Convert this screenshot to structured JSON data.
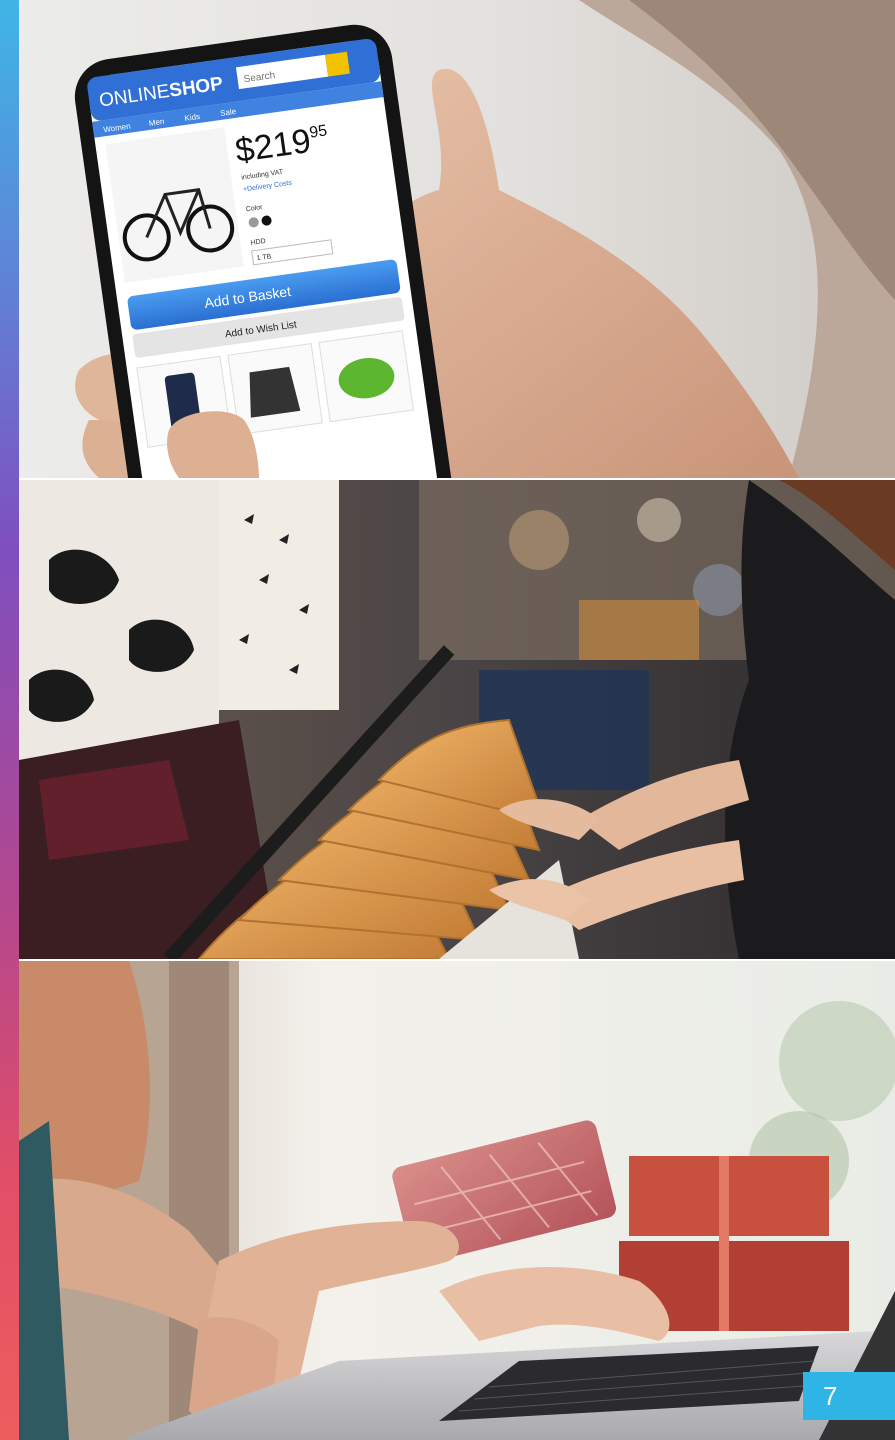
{
  "photos": [
    {
      "label": "mobile-shopping-photo"
    },
    {
      "label": "clothing-rack-photo"
    },
    {
      "label": "card-payment-photo"
    }
  ],
  "shop_screen": {
    "logo_part1": "ONLINE",
    "logo_part2": "SHOP",
    "search_placeholder": "Search",
    "nav": [
      "Women",
      "Men",
      "Kids",
      "Sale"
    ],
    "price_main": "$219",
    "price_cents": "95",
    "vat_note": "including VAT",
    "delivery_link": "+Delivery Costs",
    "color_label": "Color",
    "hdd_label": "HDD",
    "hdd_value": "1 TB",
    "add_to_basket": "Add to Basket",
    "add_to_wishlist": "Add to Wish List"
  },
  "colors": {
    "accent": "#2fb4e6",
    "shop_blue": "#2f6fd6",
    "hanger": "#d9964a"
  },
  "page_number": "7"
}
